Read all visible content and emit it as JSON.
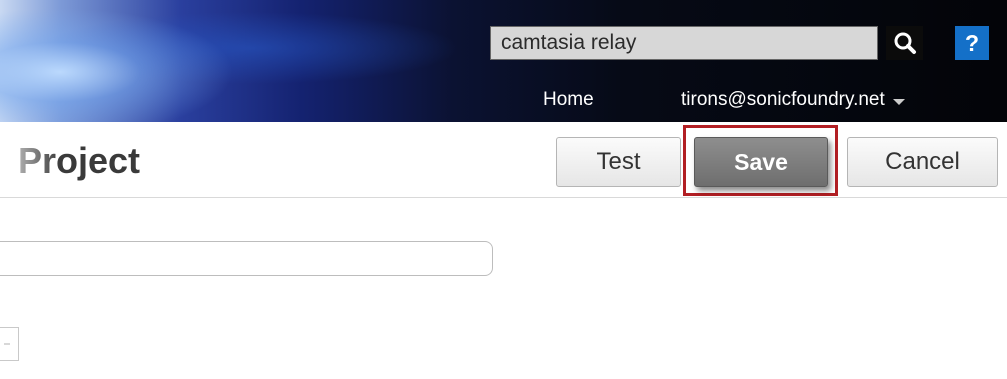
{
  "header": {
    "search": {
      "value": "camtasia relay"
    },
    "help_label": "?",
    "nav": {
      "home_label": "Home",
      "user_label": "tirons@sonicfoundry.net"
    },
    "icons": {
      "search": "search-icon",
      "user_menu": "chevron-down-icon"
    }
  },
  "page": {
    "title": "Project"
  },
  "toolbar": {
    "test_label": "Test",
    "save_label": "Save",
    "cancel_label": "Cancel",
    "highlight_color": "#b21f24"
  },
  "form": {
    "name_value": "",
    "checkbox_checked": false
  },
  "colors": {
    "help_button": "#1470c8",
    "save_button": "#7a7a7a",
    "search_button": "#0b0b0b"
  }
}
